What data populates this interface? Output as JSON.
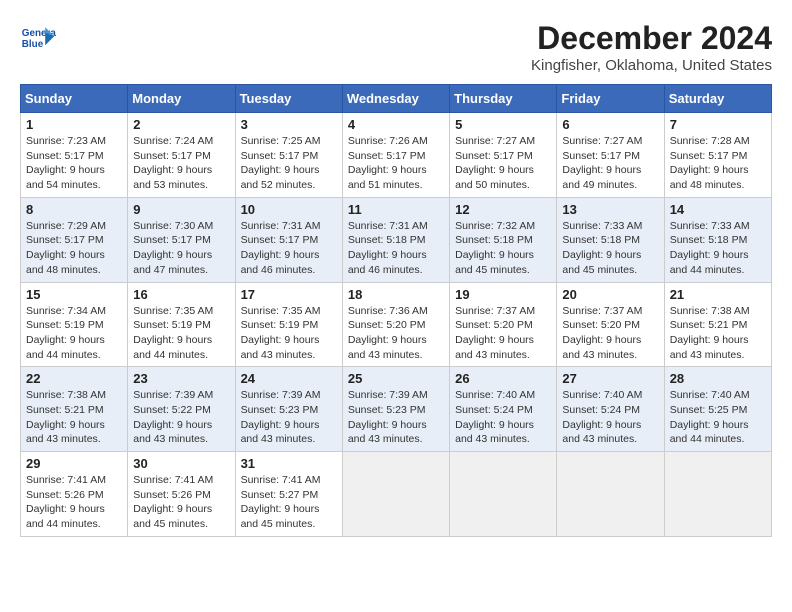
{
  "header": {
    "logo_line1": "General",
    "logo_line2": "Blue",
    "title": "December 2024",
    "subtitle": "Kingfisher, Oklahoma, United States"
  },
  "columns": [
    "Sunday",
    "Monday",
    "Tuesday",
    "Wednesday",
    "Thursday",
    "Friday",
    "Saturday"
  ],
  "weeks": [
    [
      {
        "day": 1,
        "lines": [
          "Sunrise: 7:23 AM",
          "Sunset: 5:17 PM",
          "Daylight: 9 hours",
          "and 54 minutes."
        ]
      },
      {
        "day": 2,
        "lines": [
          "Sunrise: 7:24 AM",
          "Sunset: 5:17 PM",
          "Daylight: 9 hours",
          "and 53 minutes."
        ]
      },
      {
        "day": 3,
        "lines": [
          "Sunrise: 7:25 AM",
          "Sunset: 5:17 PM",
          "Daylight: 9 hours",
          "and 52 minutes."
        ]
      },
      {
        "day": 4,
        "lines": [
          "Sunrise: 7:26 AM",
          "Sunset: 5:17 PM",
          "Daylight: 9 hours",
          "and 51 minutes."
        ]
      },
      {
        "day": 5,
        "lines": [
          "Sunrise: 7:27 AM",
          "Sunset: 5:17 PM",
          "Daylight: 9 hours",
          "and 50 minutes."
        ]
      },
      {
        "day": 6,
        "lines": [
          "Sunrise: 7:27 AM",
          "Sunset: 5:17 PM",
          "Daylight: 9 hours",
          "and 49 minutes."
        ]
      },
      {
        "day": 7,
        "lines": [
          "Sunrise: 7:28 AM",
          "Sunset: 5:17 PM",
          "Daylight: 9 hours",
          "and 48 minutes."
        ]
      }
    ],
    [
      {
        "day": 8,
        "lines": [
          "Sunrise: 7:29 AM",
          "Sunset: 5:17 PM",
          "Daylight: 9 hours",
          "and 48 minutes."
        ]
      },
      {
        "day": 9,
        "lines": [
          "Sunrise: 7:30 AM",
          "Sunset: 5:17 PM",
          "Daylight: 9 hours",
          "and 47 minutes."
        ]
      },
      {
        "day": 10,
        "lines": [
          "Sunrise: 7:31 AM",
          "Sunset: 5:17 PM",
          "Daylight: 9 hours",
          "and 46 minutes."
        ]
      },
      {
        "day": 11,
        "lines": [
          "Sunrise: 7:31 AM",
          "Sunset: 5:18 PM",
          "Daylight: 9 hours",
          "and 46 minutes."
        ]
      },
      {
        "day": 12,
        "lines": [
          "Sunrise: 7:32 AM",
          "Sunset: 5:18 PM",
          "Daylight: 9 hours",
          "and 45 minutes."
        ]
      },
      {
        "day": 13,
        "lines": [
          "Sunrise: 7:33 AM",
          "Sunset: 5:18 PM",
          "Daylight: 9 hours",
          "and 45 minutes."
        ]
      },
      {
        "day": 14,
        "lines": [
          "Sunrise: 7:33 AM",
          "Sunset: 5:18 PM",
          "Daylight: 9 hours",
          "and 44 minutes."
        ]
      }
    ],
    [
      {
        "day": 15,
        "lines": [
          "Sunrise: 7:34 AM",
          "Sunset: 5:19 PM",
          "Daylight: 9 hours",
          "and 44 minutes."
        ]
      },
      {
        "day": 16,
        "lines": [
          "Sunrise: 7:35 AM",
          "Sunset: 5:19 PM",
          "Daylight: 9 hours",
          "and 44 minutes."
        ]
      },
      {
        "day": 17,
        "lines": [
          "Sunrise: 7:35 AM",
          "Sunset: 5:19 PM",
          "Daylight: 9 hours",
          "and 43 minutes."
        ]
      },
      {
        "day": 18,
        "lines": [
          "Sunrise: 7:36 AM",
          "Sunset: 5:20 PM",
          "Daylight: 9 hours",
          "and 43 minutes."
        ]
      },
      {
        "day": 19,
        "lines": [
          "Sunrise: 7:37 AM",
          "Sunset: 5:20 PM",
          "Daylight: 9 hours",
          "and 43 minutes."
        ]
      },
      {
        "day": 20,
        "lines": [
          "Sunrise: 7:37 AM",
          "Sunset: 5:20 PM",
          "Daylight: 9 hours",
          "and 43 minutes."
        ]
      },
      {
        "day": 21,
        "lines": [
          "Sunrise: 7:38 AM",
          "Sunset: 5:21 PM",
          "Daylight: 9 hours",
          "and 43 minutes."
        ]
      }
    ],
    [
      {
        "day": 22,
        "lines": [
          "Sunrise: 7:38 AM",
          "Sunset: 5:21 PM",
          "Daylight: 9 hours",
          "and 43 minutes."
        ]
      },
      {
        "day": 23,
        "lines": [
          "Sunrise: 7:39 AM",
          "Sunset: 5:22 PM",
          "Daylight: 9 hours",
          "and 43 minutes."
        ]
      },
      {
        "day": 24,
        "lines": [
          "Sunrise: 7:39 AM",
          "Sunset: 5:23 PM",
          "Daylight: 9 hours",
          "and 43 minutes."
        ]
      },
      {
        "day": 25,
        "lines": [
          "Sunrise: 7:39 AM",
          "Sunset: 5:23 PM",
          "Daylight: 9 hours",
          "and 43 minutes."
        ]
      },
      {
        "day": 26,
        "lines": [
          "Sunrise: 7:40 AM",
          "Sunset: 5:24 PM",
          "Daylight: 9 hours",
          "and 43 minutes."
        ]
      },
      {
        "day": 27,
        "lines": [
          "Sunrise: 7:40 AM",
          "Sunset: 5:24 PM",
          "Daylight: 9 hours",
          "and 43 minutes."
        ]
      },
      {
        "day": 28,
        "lines": [
          "Sunrise: 7:40 AM",
          "Sunset: 5:25 PM",
          "Daylight: 9 hours",
          "and 44 minutes."
        ]
      }
    ],
    [
      {
        "day": 29,
        "lines": [
          "Sunrise: 7:41 AM",
          "Sunset: 5:26 PM",
          "Daylight: 9 hours",
          "and 44 minutes."
        ]
      },
      {
        "day": 30,
        "lines": [
          "Sunrise: 7:41 AM",
          "Sunset: 5:26 PM",
          "Daylight: 9 hours",
          "and 45 minutes."
        ]
      },
      {
        "day": 31,
        "lines": [
          "Sunrise: 7:41 AM",
          "Sunset: 5:27 PM",
          "Daylight: 9 hours",
          "and 45 minutes."
        ]
      },
      null,
      null,
      null,
      null
    ]
  ]
}
